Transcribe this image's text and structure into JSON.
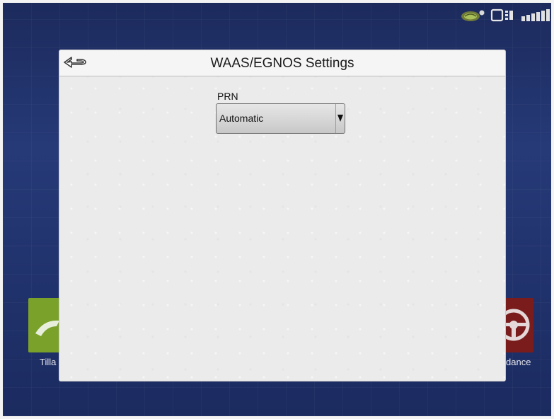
{
  "dialog": {
    "title": "WAAS/EGNOS Settings"
  },
  "prn": {
    "label": "PRN",
    "selected": "Automatic"
  },
  "background_tiles": [
    {
      "label": "Tilla",
      "icon": "tillage-icon",
      "color": "#7aa12a"
    },
    {
      "label": "dance",
      "icon": "steering-wheel-icon",
      "color": "#7a1c1c"
    }
  ],
  "status_icons": [
    "gps-status-icon",
    "display-status-icon",
    "telemetry-icon"
  ],
  "colors": {
    "background": "#263a78",
    "dialog": "#ececec",
    "select": "#d6d6d6"
  }
}
